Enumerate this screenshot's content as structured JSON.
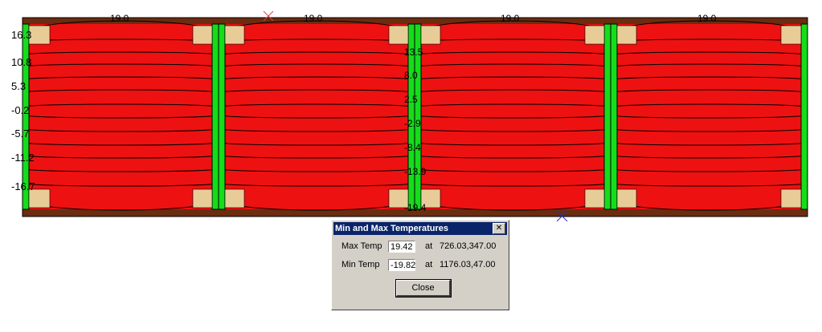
{
  "plot": {
    "top_labels": [
      "19.0",
      "19.0",
      "19.0",
      "19.0"
    ],
    "left_labels": [
      "16.3",
      "10.8",
      "5.3",
      "-0.2",
      "-5.7",
      "-11.2",
      "-16.7"
    ],
    "mid_labels": [
      "13.5",
      "8.0",
      "2.5",
      "-2.9",
      "-8.4",
      "-13.9",
      "-19.4"
    ],
    "colors": {
      "fill": "#ee1111",
      "frame": "#6b2c10",
      "stud": "#15dd1a",
      "block": "#e8cc98",
      "isotherm": "#000000",
      "marker_max": "#e04040",
      "marker_min": "#2030c0"
    }
  },
  "dialog": {
    "title": "Min and Max Temperatures",
    "close_icon": "close-x-icon",
    "max_label": "Max Temp",
    "max_value": "19.42",
    "max_at": "at",
    "max_coord": "726.03,347.00",
    "min_label": "Min Temp",
    "min_value": "-19.82",
    "min_at": "at",
    "min_coord": "1176.03,47.00",
    "close_button": "Close"
  }
}
